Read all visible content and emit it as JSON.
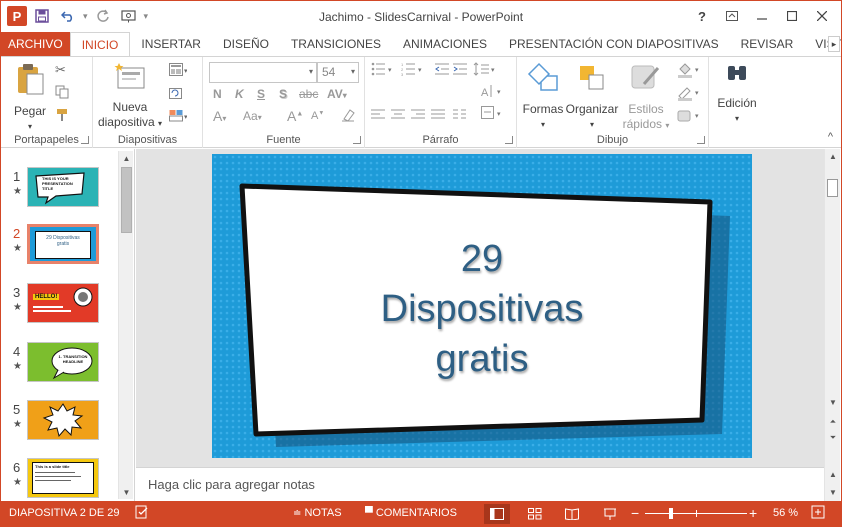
{
  "window": {
    "title": "Jachimo - SlidesCarnival - PowerPoint",
    "app_logo": "P",
    "controls": [
      "?",
      "restore-ribbon",
      "minimize",
      "maximize",
      "close"
    ]
  },
  "tabs": [
    {
      "label": "ARCHIVO"
    },
    {
      "label": "INICIO"
    },
    {
      "label": "INSERTAR"
    },
    {
      "label": "DISEÑO"
    },
    {
      "label": "TRANSICIONES"
    },
    {
      "label": "ANIMACIONES"
    },
    {
      "label": "PRESENTACIÓN CON DIAPOSITIVAS"
    },
    {
      "label": "REVISAR"
    },
    {
      "label": "VIST"
    }
  ],
  "ribbon": {
    "clipboard": {
      "paste": "Pegar",
      "group": "Portapapeles"
    },
    "slides": {
      "new_slide_1": "Nueva",
      "new_slide_2": "diapositiva",
      "group": "Diapositivas"
    },
    "font": {
      "font_name": "",
      "font_size": "54",
      "group": "Fuente",
      "bold": "N",
      "italic": "K",
      "underline": "S",
      "shadow": "S",
      "strike": "abc",
      "spacing": "AV",
      "aa": "Aa"
    },
    "paragraph": {
      "group": "Párrafo"
    },
    "drawing": {
      "shapes": "Formas",
      "arrange": "Organizar",
      "styles_1": "Estilos",
      "styles_2": "rápidos",
      "group": "Dibujo"
    },
    "editing": {
      "label": "Edición"
    }
  },
  "thumbnails": [
    {
      "num": "1",
      "text": "THIS IS YOUR PRESENTATION TITLE",
      "bg": "#2bb3b5"
    },
    {
      "num": "2",
      "text": "29 Dispositivas gratis",
      "bg": "#1e9bd8"
    },
    {
      "num": "3",
      "text": "HELLO!",
      "bg": "#e23a27"
    },
    {
      "num": "4",
      "text": "1. TRANSITION HEADLINE",
      "bg": "#7cbe2e"
    },
    {
      "num": "5",
      "text": "",
      "bg": "#f0a018"
    },
    {
      "num": "6",
      "text": "This is a slide title",
      "bg": "#f5c80f"
    }
  ],
  "slide": {
    "line1": "29",
    "line2": "Dispositivas",
    "line3": "gratis",
    "bg": "#1e9bd8",
    "text_color": "#2e5f84"
  },
  "notes": {
    "placeholder": "Haga clic para agregar notas"
  },
  "status": {
    "slide_info": "DIAPOSITIVA 2 DE 29",
    "notes": "NOTAS",
    "comments": "COMENTARIOS",
    "zoom_minus": "−",
    "zoom_plus": "+",
    "zoom": "56 %"
  },
  "colors": {
    "accent": "#d24726"
  }
}
